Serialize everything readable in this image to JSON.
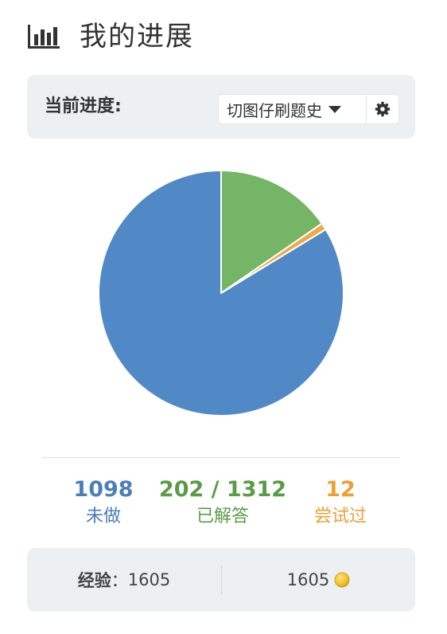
{
  "header": {
    "title": "我的进展",
    "icon": "bar-chart-icon"
  },
  "progress": {
    "label": "当前进度:",
    "selected_list": "切图仔刷题史",
    "dropdown_icon": "caret-down-icon",
    "settings_icon": "gear-icon"
  },
  "chart_data": {
    "type": "pie",
    "total": 1312,
    "slices": [
      {
        "label": "已解答",
        "value": 202,
        "color": "#74b566"
      },
      {
        "label": "尝试过",
        "value": 12,
        "color": "#f0a847"
      },
      {
        "label": "未做",
        "value": 1098,
        "color": "#5189c6"
      }
    ]
  },
  "stats": {
    "todo": {
      "value": "1098",
      "label": "未做",
      "color": "#4a7fba"
    },
    "solved": {
      "value": "202 / 1312",
      "label": "已解答",
      "color": "#5a9b48"
    },
    "attempted": {
      "value": "12",
      "label": "尝试过",
      "color": "#eba035"
    }
  },
  "info": {
    "exp_label": "经验",
    "exp_colon": "：",
    "exp_value": "1605",
    "coins_value": "1605",
    "coin_icon": "coin-icon"
  }
}
